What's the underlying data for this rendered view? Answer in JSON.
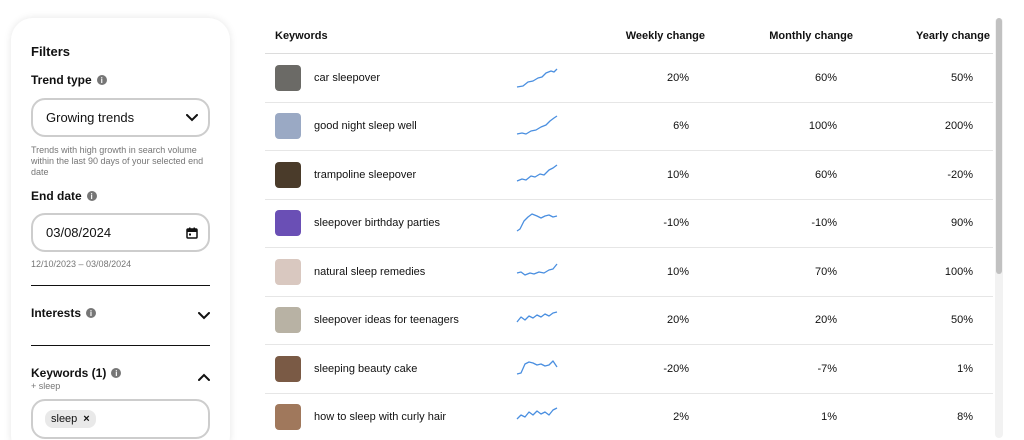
{
  "filters": {
    "title": "Filters",
    "trend_type_label": "Trend type",
    "trend_type_value": "Growing trends",
    "trend_help": "Trends with high growth in search volume within the last 90 days of your selected end date",
    "end_date_label": "End date",
    "end_date_value": "03/08/2024",
    "date_range": "12/10/2023 – 03/08/2024",
    "interests_label": "Interests",
    "keywords_label": "Keywords (1)",
    "keywords_sub": "+ sleep",
    "chip_label": "sleep",
    "chip_remove": "×"
  },
  "table": {
    "headers": {
      "keywords": "Keywords",
      "weekly": "Weekly change",
      "monthly": "Monthly change",
      "yearly": "Yearly change"
    },
    "rows": [
      {
        "keyword": "car sleepover",
        "weekly": "20%",
        "monthly": "60%",
        "yearly": "50%",
        "thumb_color": "#6b6a66"
      },
      {
        "keyword": "good night sleep well",
        "weekly": "6%",
        "monthly": "100%",
        "yearly": "200%",
        "thumb_color": "#9aa9c4"
      },
      {
        "keyword": "trampoline sleepover",
        "weekly": "10%",
        "monthly": "60%",
        "yearly": "-20%",
        "thumb_color": "#4a3b2a"
      },
      {
        "keyword": "sleepover birthday parties",
        "weekly": "-10%",
        "monthly": "-10%",
        "yearly": "90%",
        "thumb_color": "#6a4fb5"
      },
      {
        "keyword": "natural sleep remedies",
        "weekly": "10%",
        "monthly": "70%",
        "yearly": "100%",
        "thumb_color": "#d9c8c0"
      },
      {
        "keyword": "sleepover ideas for teenagers",
        "weekly": "20%",
        "monthly": "20%",
        "yearly": "50%",
        "thumb_color": "#b8b2a4"
      },
      {
        "keyword": "sleeping beauty cake",
        "weekly": "-20%",
        "monthly": "-7%",
        "yearly": "1%",
        "thumb_color": "#7a5a45"
      },
      {
        "keyword": "how to sleep with curly hair",
        "weekly": "2%",
        "monthly": "1%",
        "yearly": "8%",
        "thumb_color": "#a0785c"
      }
    ]
  },
  "colors": {
    "sparkline": "#4a8fe0",
    "border": "#cdcdcd",
    "muted_text": "#767676"
  }
}
